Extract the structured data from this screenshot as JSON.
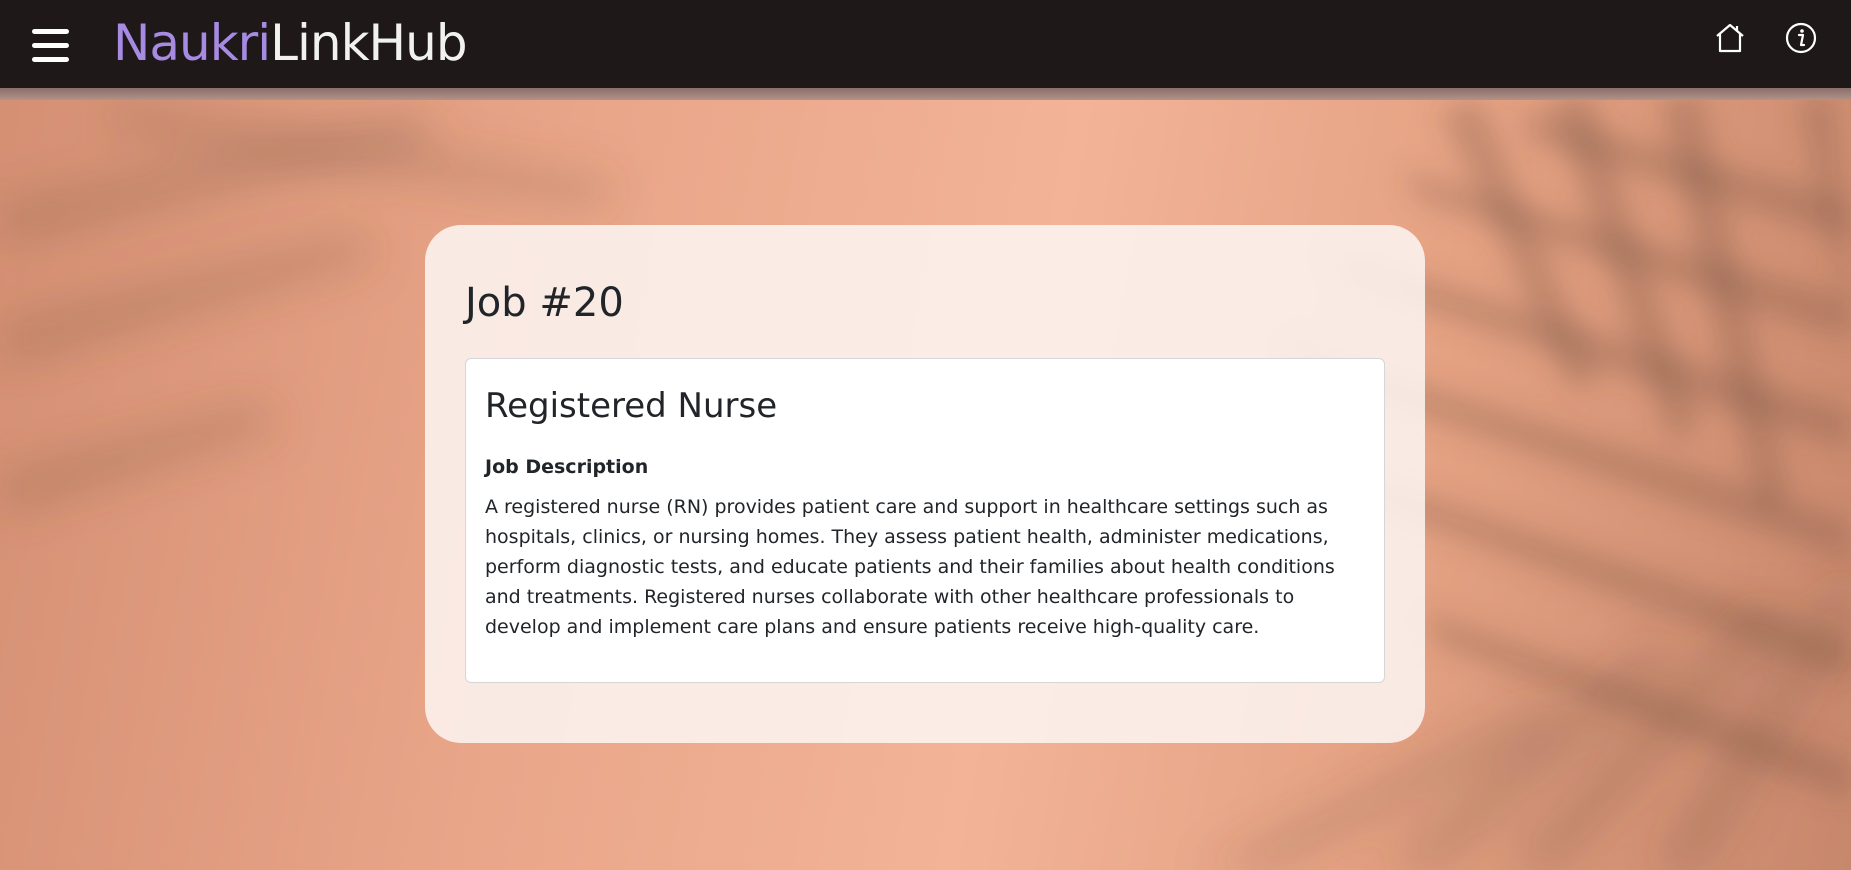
{
  "brand": {
    "part1": "Naukri",
    "part2": "LinkHub",
    "part1_color": "#a78ae2",
    "part2_color": "#f1f1f1"
  },
  "nav": {
    "menu_icon": "hamburger-menu-icon",
    "home_icon": "home-icon",
    "info_icon": "info-icon"
  },
  "job": {
    "heading": "Job #20",
    "title": "Registered Nurse",
    "description_label": "Job Description",
    "description": "A registered nurse (RN) provides patient care and support in healthcare settings such as hospitals, clinics, or nursing homes. They assess patient health, administer medications, perform diagnostic tests, and educate patients and their families about health conditions and treatments. Registered nurses collaborate with other healthcare professionals to develop and implement care plans and ensure patients receive high-quality care."
  },
  "colors": {
    "navbar": "#1e1819",
    "background": "#e9a588",
    "card": "#fcf4f0"
  }
}
